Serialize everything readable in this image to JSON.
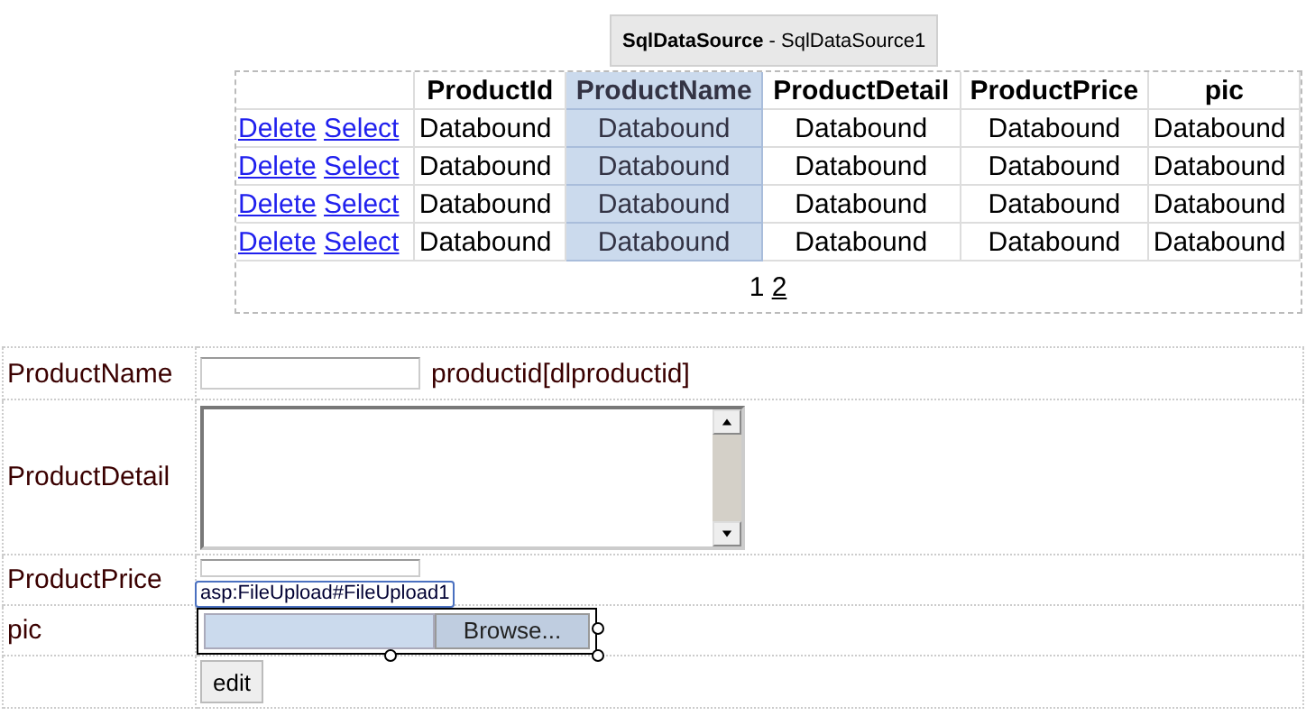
{
  "datasource": {
    "label": "**SqlDataSource** - SqlDataSource1"
  },
  "grid": {
    "columns": [
      {
        "label": "ProductId",
        "selected": false
      },
      {
        "label": "ProductName",
        "selected": true
      },
      {
        "label": "ProductDetail",
        "selected": false
      },
      {
        "label": "ProductPrice",
        "selected": false
      },
      {
        "label": "pic",
        "selected": false
      }
    ],
    "rows": [
      {
        "links": [
          "Delete",
          "Select"
        ],
        "cells": [
          "Databound",
          "Databound",
          "Databound",
          "Databound",
          "Databound"
        ]
      },
      {
        "links": [
          "Delete",
          "Select"
        ],
        "cells": [
          "Databound",
          "Databound",
          "Databound",
          "Databound",
          "Databound"
        ]
      },
      {
        "links": [
          "Delete",
          "Select"
        ],
        "cells": [
          "Databound",
          "Databound",
          "Databound",
          "Databound",
          "Databound"
        ]
      },
      {
        "links": [
          "Delete",
          "Select"
        ],
        "cells": [
          "Databound",
          "Databound",
          "Databound",
          "Databound",
          "Databound"
        ]
      }
    ],
    "pager": [
      {
        "label": "1",
        "selected": true
      },
      {
        "label": "2",
        "selected": false
      }
    ]
  },
  "form": {
    "product_name_label": "ProductName",
    "product_id_binding": "productid[dlproductid]",
    "product_detail_label": "ProductDetail",
    "product_price_label": "ProductPrice",
    "pic_label": "pic",
    "upload_tag": "asp:FileUpload#FileUpload1",
    "browse_button": "Browse...",
    "edit_button": "edit"
  }
}
